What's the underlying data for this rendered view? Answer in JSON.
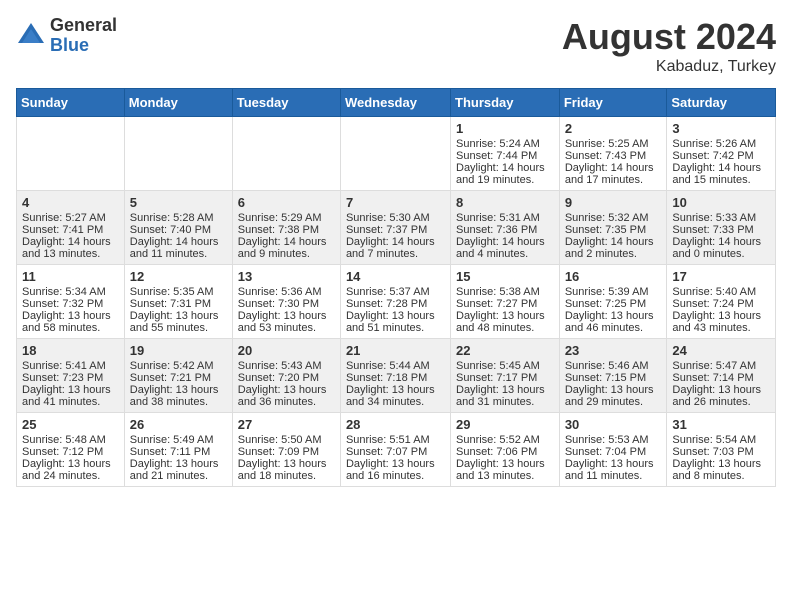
{
  "logo": {
    "general": "General",
    "blue": "Blue"
  },
  "title": {
    "month_year": "August 2024",
    "location": "Kabaduz, Turkey"
  },
  "weekdays": [
    "Sunday",
    "Monday",
    "Tuesday",
    "Wednesday",
    "Thursday",
    "Friday",
    "Saturday"
  ],
  "weeks": [
    [
      {
        "day": "",
        "info": ""
      },
      {
        "day": "",
        "info": ""
      },
      {
        "day": "",
        "info": ""
      },
      {
        "day": "",
        "info": ""
      },
      {
        "day": "1",
        "info": "Sunrise: 5:24 AM\nSunset: 7:44 PM\nDaylight: 14 hours\nand 19 minutes."
      },
      {
        "day": "2",
        "info": "Sunrise: 5:25 AM\nSunset: 7:43 PM\nDaylight: 14 hours\nand 17 minutes."
      },
      {
        "day": "3",
        "info": "Sunrise: 5:26 AM\nSunset: 7:42 PM\nDaylight: 14 hours\nand 15 minutes."
      }
    ],
    [
      {
        "day": "4",
        "info": "Sunrise: 5:27 AM\nSunset: 7:41 PM\nDaylight: 14 hours\nand 13 minutes."
      },
      {
        "day": "5",
        "info": "Sunrise: 5:28 AM\nSunset: 7:40 PM\nDaylight: 14 hours\nand 11 minutes."
      },
      {
        "day": "6",
        "info": "Sunrise: 5:29 AM\nSunset: 7:38 PM\nDaylight: 14 hours\nand 9 minutes."
      },
      {
        "day": "7",
        "info": "Sunrise: 5:30 AM\nSunset: 7:37 PM\nDaylight: 14 hours\nand 7 minutes."
      },
      {
        "day": "8",
        "info": "Sunrise: 5:31 AM\nSunset: 7:36 PM\nDaylight: 14 hours\nand 4 minutes."
      },
      {
        "day": "9",
        "info": "Sunrise: 5:32 AM\nSunset: 7:35 PM\nDaylight: 14 hours\nand 2 minutes."
      },
      {
        "day": "10",
        "info": "Sunrise: 5:33 AM\nSunset: 7:33 PM\nDaylight: 14 hours\nand 0 minutes."
      }
    ],
    [
      {
        "day": "11",
        "info": "Sunrise: 5:34 AM\nSunset: 7:32 PM\nDaylight: 13 hours\nand 58 minutes."
      },
      {
        "day": "12",
        "info": "Sunrise: 5:35 AM\nSunset: 7:31 PM\nDaylight: 13 hours\nand 55 minutes."
      },
      {
        "day": "13",
        "info": "Sunrise: 5:36 AM\nSunset: 7:30 PM\nDaylight: 13 hours\nand 53 minutes."
      },
      {
        "day": "14",
        "info": "Sunrise: 5:37 AM\nSunset: 7:28 PM\nDaylight: 13 hours\nand 51 minutes."
      },
      {
        "day": "15",
        "info": "Sunrise: 5:38 AM\nSunset: 7:27 PM\nDaylight: 13 hours\nand 48 minutes."
      },
      {
        "day": "16",
        "info": "Sunrise: 5:39 AM\nSunset: 7:25 PM\nDaylight: 13 hours\nand 46 minutes."
      },
      {
        "day": "17",
        "info": "Sunrise: 5:40 AM\nSunset: 7:24 PM\nDaylight: 13 hours\nand 43 minutes."
      }
    ],
    [
      {
        "day": "18",
        "info": "Sunrise: 5:41 AM\nSunset: 7:23 PM\nDaylight: 13 hours\nand 41 minutes."
      },
      {
        "day": "19",
        "info": "Sunrise: 5:42 AM\nSunset: 7:21 PM\nDaylight: 13 hours\nand 38 minutes."
      },
      {
        "day": "20",
        "info": "Sunrise: 5:43 AM\nSunset: 7:20 PM\nDaylight: 13 hours\nand 36 minutes."
      },
      {
        "day": "21",
        "info": "Sunrise: 5:44 AM\nSunset: 7:18 PM\nDaylight: 13 hours\nand 34 minutes."
      },
      {
        "day": "22",
        "info": "Sunrise: 5:45 AM\nSunset: 7:17 PM\nDaylight: 13 hours\nand 31 minutes."
      },
      {
        "day": "23",
        "info": "Sunrise: 5:46 AM\nSunset: 7:15 PM\nDaylight: 13 hours\nand 29 minutes."
      },
      {
        "day": "24",
        "info": "Sunrise: 5:47 AM\nSunset: 7:14 PM\nDaylight: 13 hours\nand 26 minutes."
      }
    ],
    [
      {
        "day": "25",
        "info": "Sunrise: 5:48 AM\nSunset: 7:12 PM\nDaylight: 13 hours\nand 24 minutes."
      },
      {
        "day": "26",
        "info": "Sunrise: 5:49 AM\nSunset: 7:11 PM\nDaylight: 13 hours\nand 21 minutes."
      },
      {
        "day": "27",
        "info": "Sunrise: 5:50 AM\nSunset: 7:09 PM\nDaylight: 13 hours\nand 18 minutes."
      },
      {
        "day": "28",
        "info": "Sunrise: 5:51 AM\nSunset: 7:07 PM\nDaylight: 13 hours\nand 16 minutes."
      },
      {
        "day": "29",
        "info": "Sunrise: 5:52 AM\nSunset: 7:06 PM\nDaylight: 13 hours\nand 13 minutes."
      },
      {
        "day": "30",
        "info": "Sunrise: 5:53 AM\nSunset: 7:04 PM\nDaylight: 13 hours\nand 11 minutes."
      },
      {
        "day": "31",
        "info": "Sunrise: 5:54 AM\nSunset: 7:03 PM\nDaylight: 13 hours\nand 8 minutes."
      }
    ]
  ]
}
